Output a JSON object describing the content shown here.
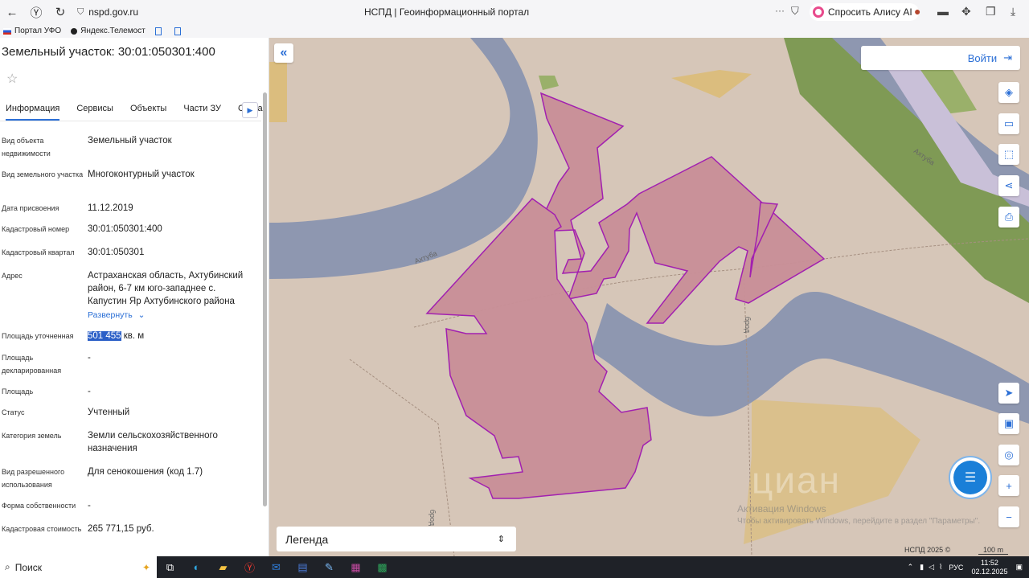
{
  "browser": {
    "url": "nspd.gov.ru",
    "page_title": "НСПД | Геоинформационный портал",
    "alice_label": "Спросить Алису AI",
    "bookmarks": [
      "Портал УФО",
      "Яндекс.Телемост"
    ]
  },
  "panel": {
    "title": "Земельный участок: 30:01:050301:400",
    "tabs": [
      "Информация",
      "Сервисы",
      "Объекты",
      "Части ЗУ",
      "Соста"
    ],
    "fields": [
      {
        "label": "Вид объекта недвижимости",
        "value": "Земельный участок"
      },
      {
        "label": "Вид земельного участка",
        "value": "Многоконтурный участок"
      },
      {
        "label": "Дата присвоения",
        "value": "11.12.2019"
      },
      {
        "label": "Кадастровый номер",
        "value": "30:01:050301:400"
      },
      {
        "label": "Кадастровый квартал",
        "value": "30:01:050301"
      },
      {
        "label": "Адрес",
        "value": "Астраханская область, Ахтубинский район, 6-7 км юго-западнее с. Капустин Яр Ахтубинского района"
      },
      {
        "label": "Площадь уточненная",
        "value_number": "501 455",
        "value_unit": " кв. м"
      },
      {
        "label": "Площадь декларированная",
        "value": "-"
      },
      {
        "label": "Площадь",
        "value": "-"
      },
      {
        "label": "Статус",
        "value": "Учтенный"
      },
      {
        "label": "Категория земель",
        "value": "Земли сельскохозяйственного назначения"
      },
      {
        "label": "Вид разрешенного использования",
        "value": "Для сенокошения (код 1.7)"
      },
      {
        "label": "Форма собственности",
        "value": "-"
      },
      {
        "label": "Кадастровая стоимость",
        "value": "265 771,15 руб."
      }
    ],
    "expand_label": "Развернуть"
  },
  "map": {
    "login_label": "Войти",
    "legend_label": "Легенда",
    "river_label_1": "Ахтуба",
    "river_label_2": "Ахтуба",
    "ford_label": "брод",
    "ford_label_2": "брод",
    "watermark_1": "Активация Windows",
    "watermark_2": "Чтобы активировать Windows, перейдите в раздел \"Параметры\".",
    "cian": "циан",
    "copyright": "НСПД 2025 ©",
    "scale": "100 m"
  },
  "taskbar": {
    "search_label": "Поиск",
    "lang": "РУС",
    "time": "11:52",
    "date": "02.12.2025"
  },
  "colors": {
    "accent": "#2b6fd6",
    "parcel_fill": "#c98f98",
    "parcel_stroke": "#a018b0",
    "river": "#8e97b0",
    "meadow": "#7f9a55",
    "field": "#dbbd7e"
  }
}
